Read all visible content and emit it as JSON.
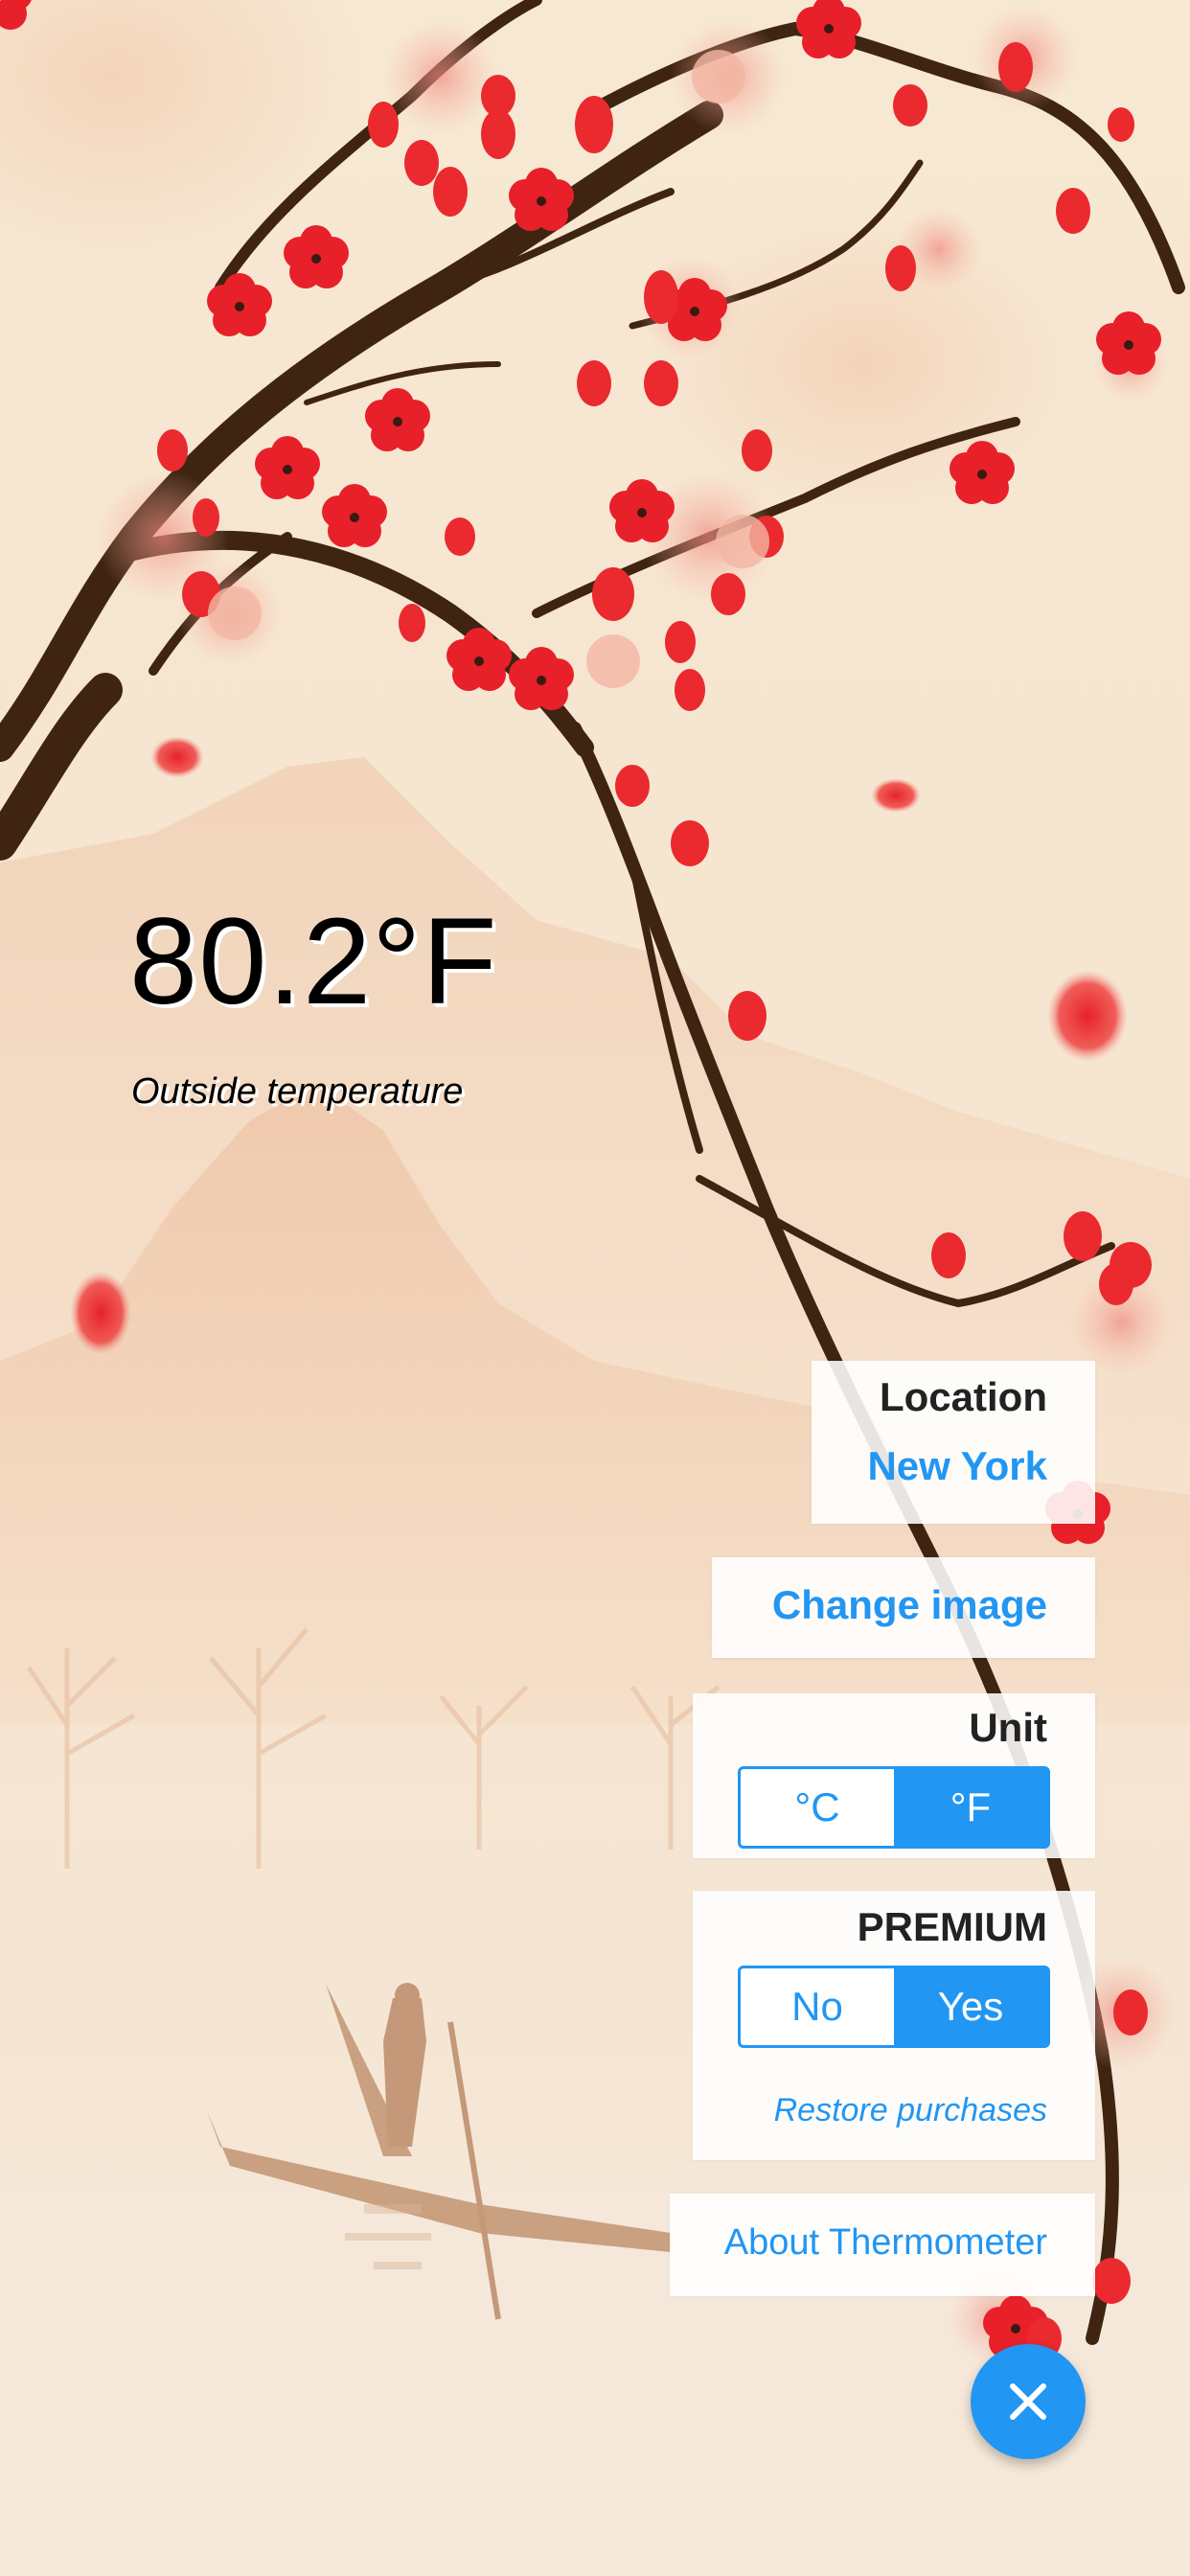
{
  "temperature": {
    "value": "80.2°F",
    "caption": "Outside temperature"
  },
  "location": {
    "title": "Location",
    "city": "New York"
  },
  "change_image": {
    "label": "Change image"
  },
  "unit": {
    "title": "Unit",
    "options": [
      "°C",
      "°F"
    ],
    "selected": "°F"
  },
  "premium": {
    "title": "PREMIUM",
    "options": [
      "No",
      "Yes"
    ],
    "selected": "Yes",
    "restore_label": "Restore purchases"
  },
  "about": {
    "label": "About Thermometer"
  },
  "fab": {
    "icon": "close-icon"
  },
  "colors": {
    "accent": "#2196f3",
    "background": "#f6e6d2",
    "blossom": "#e8202a",
    "branch": "#4a2a14"
  }
}
